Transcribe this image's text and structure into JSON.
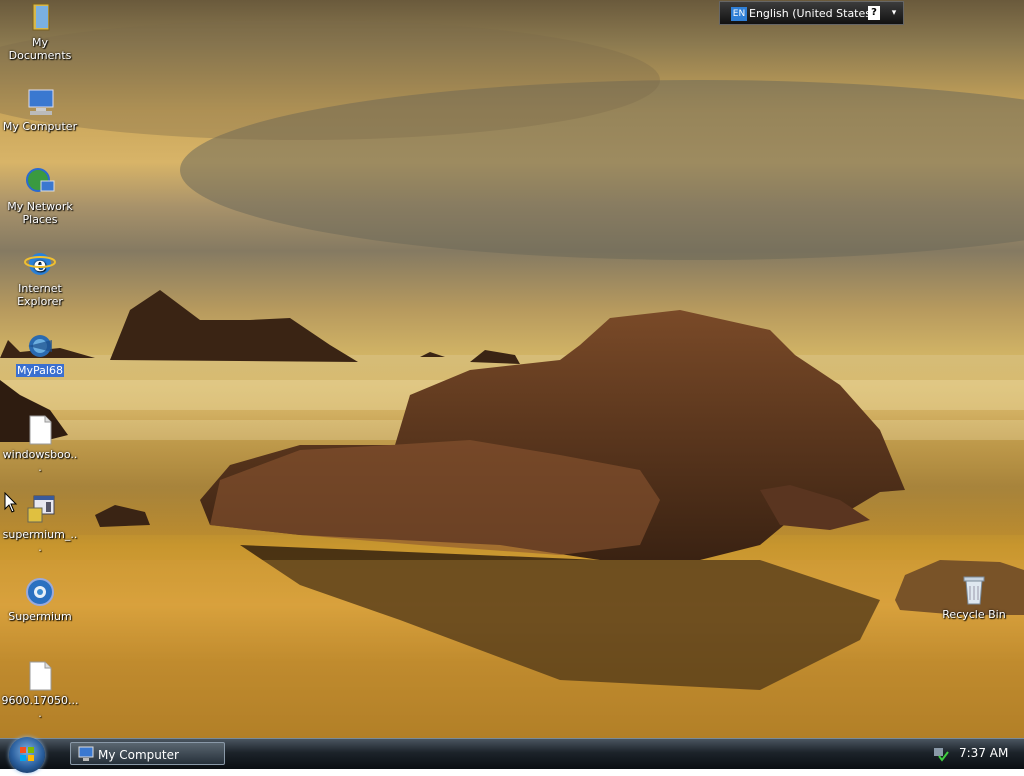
{
  "desktop": {
    "icons": [
      {
        "label": "My Documents",
        "icon": "my-documents-icon"
      },
      {
        "label": "My Computer",
        "icon": "my-computer-icon"
      },
      {
        "label": "My Network Places",
        "icon": "network-places-icon"
      },
      {
        "label": "Internet Explorer",
        "icon": "internet-explorer-icon"
      },
      {
        "label": "MyPal68",
        "icon": "mypal-icon"
      },
      {
        "label": "windowsboo...",
        "icon": "document-icon"
      },
      {
        "label": "supermium_...",
        "icon": "installer-icon"
      },
      {
        "label": "Supermium",
        "icon": "supermium-icon"
      },
      {
        "label": "9600.17050....",
        "icon": "document-icon"
      },
      {
        "label": "Recycle Bin",
        "icon": "recycle-bin-icon"
      }
    ]
  },
  "language_bar": {
    "code": "EN",
    "language": "English (United States)",
    "help": "?",
    "options": "▾"
  },
  "taskbar": {
    "task_label": "My Computer",
    "clock": "7:37 AM"
  },
  "colors": {
    "selection": "#3a6fd0",
    "taskbar": "#1c232a"
  }
}
